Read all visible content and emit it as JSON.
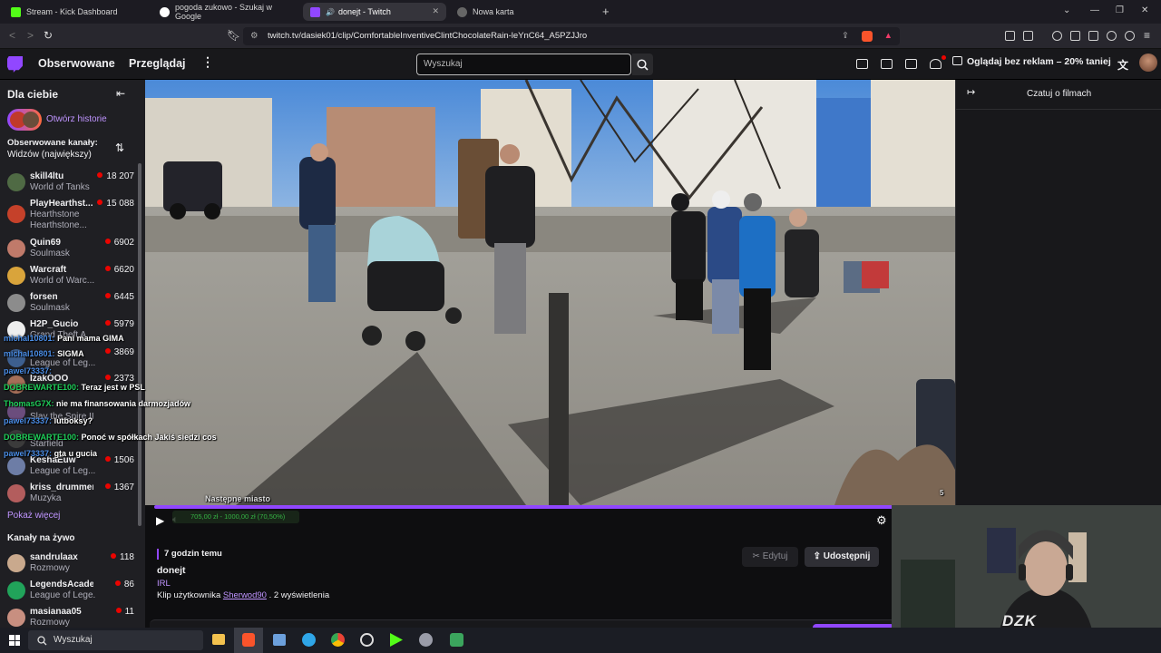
{
  "browser": {
    "tabs": [
      {
        "title": "Stream - Kick Dashboard",
        "active": false,
        "favicon_color": "#53fc18"
      },
      {
        "title": "pogoda zukowo - Szukaj w Google",
        "active": false,
        "favicon_color": "#ffffff"
      },
      {
        "title": "donejt - Twitch",
        "active": true,
        "favicon_color": "#9147ff"
      },
      {
        "title": "Nowa karta",
        "active": false,
        "favicon_color": "#888888"
      }
    ],
    "new_tab_icon": "plus-icon",
    "url": "twitch.tv/dasiek01/clip/ComfortableInventiveClintChocolateRain-leYnC64_A5PZJJro"
  },
  "header": {
    "nav_following": "Obserwowane",
    "nav_browse": "Przeglądaj",
    "search_placeholder": "Wyszukaj",
    "prime_offer": "Oglądaj bez reklam – 20% taniej"
  },
  "sidebar": {
    "title": "Dla ciebie",
    "stories_label": "Otwórz historie",
    "followed_label": "Obserwowane kanały:",
    "sort_label": "Widzów (największy)",
    "followed": [
      {
        "name": "skill4ltu",
        "game": "World of Tanks",
        "viewers": "18 207",
        "color": "#4f6a44"
      },
      {
        "name": "PlayHearthst...",
        "game": "Hearthstone",
        "extra": "Hearthstone...",
        "viewers": "15 088",
        "color": "#c5412a"
      },
      {
        "name": "Quin69",
        "game": "Soulmask",
        "viewers": "6902",
        "color": "#c07a6a"
      },
      {
        "name": "Warcraft",
        "game": "World of Warc...",
        "viewers": "6620",
        "color": "#d9a43b"
      },
      {
        "name": "forsen",
        "game": "Soulmask",
        "viewers": "6445",
        "color": "#8c8c8c"
      },
      {
        "name": "H2P_Gucio",
        "game": "Grand Theft A...",
        "viewers": "5979",
        "color": "#eeeeee"
      },
      {
        "name": "MrNightmare",
        "game": "League of Leg...",
        "viewers": "3869",
        "color": "#3d5f8f"
      },
      {
        "name": "IzakOOO",
        "game": "",
        "viewers": "2373",
        "color": "#a66f58"
      },
      {
        "name": "",
        "game": "Slay the Spire II",
        "viewers": "",
        "color": "#6b4d7d"
      },
      {
        "name": "",
        "game": "Starfield",
        "viewers": "",
        "color": "#3b3b3b"
      },
      {
        "name": "KeshaEuw",
        "game": "League of Leg...",
        "viewers": "1506",
        "color": "#6d7da6"
      },
      {
        "name": "kriss_drummer",
        "game": "Muzyka",
        "viewers": "1367",
        "color": "#b35d5d"
      }
    ],
    "show_more": "Pokaż więcej",
    "live_label": "Kanały na żywo",
    "live": [
      {
        "name": "sandrulaax",
        "game": "Rozmowy",
        "viewers": "118",
        "color": "#c9a98d"
      },
      {
        "name": "LegendsAcade...",
        "game": "League of Lege...",
        "viewers": "86",
        "color": "#21a35a"
      },
      {
        "name": "masianaa05",
        "game": "Rozmowy",
        "viewers": "11",
        "color": "#c88f80"
      }
    ]
  },
  "chat_overlay": [
    {
      "user": "michal10801:",
      "text": "Pani mama GIMA"
    },
    {
      "user": "michal10801:",
      "text": "SIGMA"
    },
    {
      "user": "pawel73337:",
      "text": ""
    },
    {
      "user": "DOBREWARTE100:",
      "text": "Teraz jest w PSL"
    },
    {
      "user": "ThomasG7X:",
      "text": "nie ma finansowania darmozjadów"
    },
    {
      "user": "pawel73337:",
      "text": "lutboksy?"
    },
    {
      "user": "DOBREWARTE100:",
      "text": "Ponoć w spółkach Jakiś siedzi cos"
    },
    {
      "user": "pawel73337:",
      "text": "gta u gucia"
    }
  ],
  "video": {
    "overlay_text": "Następne miasto",
    "counter": "5",
    "goal_text": "705,00 zł - 1000,00 zł (70,50%)"
  },
  "clip": {
    "time_ago": "7 godzin temu",
    "title": "donejt",
    "category": "IRL",
    "by_prefix": "Klip użytkownika",
    "author": "Sherwod90",
    "views": ". 2 wyświetlenia",
    "edit_label": "Edytuj",
    "share_label": "Udostępnij"
  },
  "chat_panel": {
    "title": "Czatuj o filmach"
  },
  "taskbar": {
    "search_placeholder": "Wyszukaj"
  },
  "webcam": {
    "shirt_text": "DZK"
  }
}
